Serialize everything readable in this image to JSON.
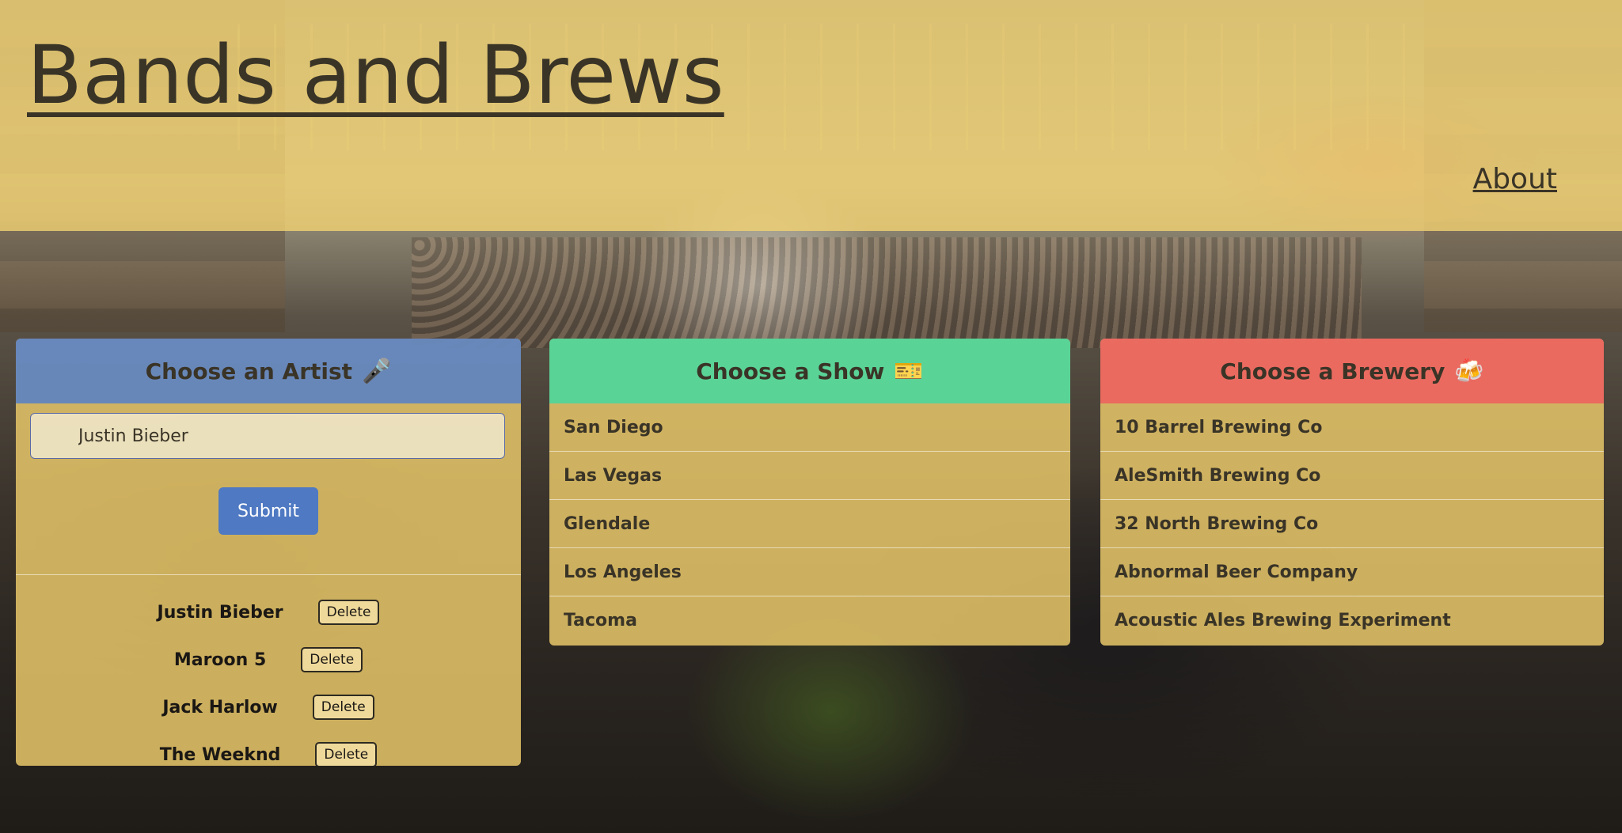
{
  "header": {
    "title": "Bands and Brews",
    "about_label": "About"
  },
  "artist_panel": {
    "heading": "Choose an Artist",
    "heading_icon": "microphone-icon",
    "heading_icon_glyph": "🎤",
    "input_value": "Justin Bieber",
    "submit_label": "Submit",
    "delete_label": "Delete",
    "artists": [
      {
        "name": "Justin Bieber"
      },
      {
        "name": "Maroon 5"
      },
      {
        "name": "Jack Harlow"
      },
      {
        "name": "The Weeknd"
      }
    ]
  },
  "show_panel": {
    "heading": "Choose a Show",
    "heading_icon": "ticket-icon",
    "heading_icon_glyph": "🎫",
    "shows": [
      "San Diego",
      "Las Vegas",
      "Glendale",
      "Los Angeles",
      "Tacoma"
    ]
  },
  "brewery_panel": {
    "heading": "Choose a Brewery",
    "heading_icon": "beer-mugs-icon",
    "heading_icon_glyph": "🍻",
    "breweries": [
      "10 Barrel Brewing Co",
      "AleSmith Brewing Co",
      "32 North Brewing Co",
      "Abnormal Beer Company",
      "Acoustic Ales Brewing Experiment"
    ]
  },
  "colors": {
    "header_overlay": "#f1d273",
    "card_body": "#e3c368",
    "artist_header": "#5c82c3",
    "show_header": "#4cd69c",
    "brewery_header": "#ec6460",
    "submit_button": "#4f79c2"
  }
}
